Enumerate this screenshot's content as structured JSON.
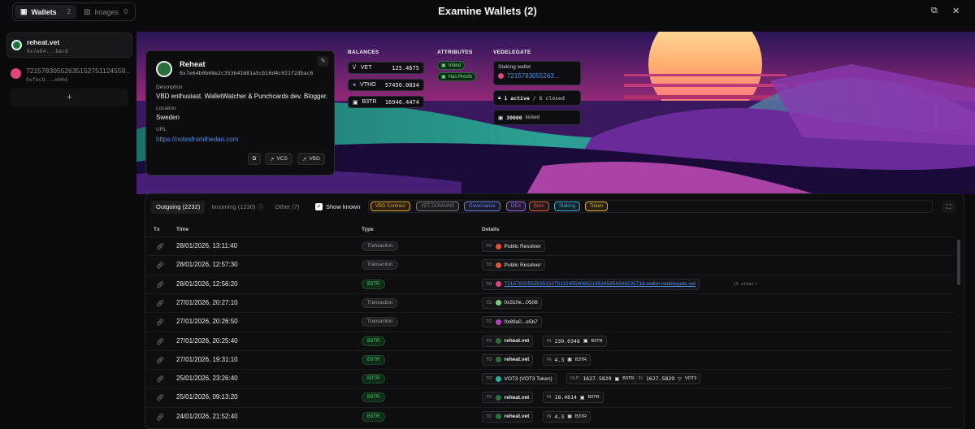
{
  "header": {
    "title": "Examine Wallets (2)",
    "tabs": [
      {
        "label": "Wallets",
        "count": "2"
      },
      {
        "label": "Images",
        "count": "0"
      }
    ]
  },
  "sidebar": {
    "wallets": [
      {
        "name": "reheat.vet",
        "address": "0x7e64...bac6",
        "color": "#2a6e3b"
      },
      {
        "name": "72157830552635152751124559...",
        "address": "0xfec9...e00d",
        "color": "#e0457b"
      }
    ],
    "add_label": "+"
  },
  "profile": {
    "name": "Reheat",
    "address": "0x7e64b0b68e2c353641681a5cb16d4c021f2dbac6",
    "description_label": "Description",
    "description": "VBD enthusiast. WalletWatcher & Punchcards dev. Blogger.",
    "location_label": "Location",
    "location": "Sweden",
    "url_label": "URL",
    "url": "https://notesfromthedao.com",
    "buttons": {
      "vcs": "VCS",
      "vbd": "VBD"
    }
  },
  "balances": {
    "label": "BALANCES",
    "items": [
      {
        "token": "VET",
        "amount": "125.4675"
      },
      {
        "token": "VTHO",
        "amount": "57450.0034"
      },
      {
        "token": "B3TR",
        "amount": "16946.4474"
      }
    ]
  },
  "attributes": {
    "label": "ATTRIBUTES",
    "items": [
      "Voted",
      "Has Proofs"
    ]
  },
  "vedelegate": {
    "label": "VEDELEGATE",
    "staking_label": "Staking wallet",
    "staking_wallet": "7215783055263...",
    "active": "1 active",
    "closed": "/ 6 closed",
    "locked_amount": "30000",
    "locked_label": "locked"
  },
  "filters": {
    "tabs": [
      {
        "label": "Outgoing (2232)"
      },
      {
        "label": "Incoming (1230)"
      },
      {
        "label": "Other (7)"
      }
    ],
    "show_known": "Show known",
    "chips": [
      {
        "label": "VBD Contract",
        "color": "#e0a020"
      },
      {
        "label": "VET DOMAINS",
        "color": "#7a7a82"
      },
      {
        "label": "Governance",
        "color": "#6a7fe0"
      },
      {
        "label": "DEX",
        "color": "#9a6ae0"
      },
      {
        "label": "Burn",
        "color": "#e05a3a"
      },
      {
        "label": "Staking",
        "color": "#3aa8d0"
      },
      {
        "label": "Token",
        "color": "#e0b030"
      }
    ]
  },
  "table": {
    "headers": {
      "tx": "Tx",
      "time": "Time",
      "type": "Type",
      "details": "Details"
    },
    "rows": [
      {
        "time": "28/01/2026, 13:11:40",
        "type": "Transaction",
        "details": [
          {
            "k": "TO",
            "v": "Public Resolver",
            "c": "#e0503a"
          }
        ]
      },
      {
        "time": "28/01/2026, 12:57:30",
        "type": "Transaction",
        "details": [
          {
            "k": "TO",
            "v": "Public Resolver",
            "c": "#e0503a"
          }
        ]
      },
      {
        "time": "28/01/2026, 12:56:20",
        "type": "B3TR",
        "details": [
          {
            "k": "TO",
            "v": "72157830552635152751124559066214534585434423571​8.wallet.vedelegate.vet",
            "c": "#e0457b",
            "link": true
          }
        ],
        "extra": "(3 other)"
      },
      {
        "time": "27/01/2026, 20:27:10",
        "type": "Transaction",
        "details": [
          {
            "k": "TO",
            "v": "0x310e...0508",
            "c": "#7ad07a"
          }
        ]
      },
      {
        "time": "27/01/2026, 20:26:50",
        "type": "Transaction",
        "details": [
          {
            "k": "TO",
            "v": "0x89a0...e5b7",
            "c": "#b040c0"
          }
        ]
      },
      {
        "time": "27/01/2026, 20:25:40",
        "type": "B3TR",
        "details": [
          {
            "k": "TO",
            "v": "reheat.vet",
            "c": "#2a6e3b"
          },
          {
            "k": "IN",
            "v": "239.0348",
            "t": "B3TR"
          }
        ]
      },
      {
        "time": "27/01/2026, 19:31:10",
        "type": "B3TR",
        "details": [
          {
            "k": "TO",
            "v": "reheat.vet",
            "c": "#2a6e3b"
          },
          {
            "k": "IN",
            "v": "4.3",
            "t": "B3TR"
          }
        ]
      },
      {
        "time": "25/01/2026, 23:26:40",
        "type": "B3TR",
        "details": [
          {
            "k": "TO",
            "v": "VOT3 (VOT3 Token)",
            "c": "#2ab0a0"
          },
          {
            "k": "OUT",
            "v": "1627.5829",
            "t": "B3TR"
          },
          {
            "k": "IN",
            "v": "1627.5829",
            "t": "VOT3"
          }
        ]
      },
      {
        "time": "25/01/2026, 09:13:20",
        "type": "B3TR",
        "details": [
          {
            "k": "TO",
            "v": "reheat.vet",
            "c": "#2a6e3b"
          },
          {
            "k": "IN",
            "v": "18.4814",
            "t": "B3TR"
          }
        ]
      },
      {
        "time": "24/01/2026, 21:52:40",
        "type": "B3TR",
        "details": [
          {
            "k": "TO",
            "v": "reheat.vet",
            "c": "#2a6e3b"
          },
          {
            "k": "IN",
            "v": "4.3",
            "t": "B3TR"
          }
        ]
      }
    ]
  }
}
